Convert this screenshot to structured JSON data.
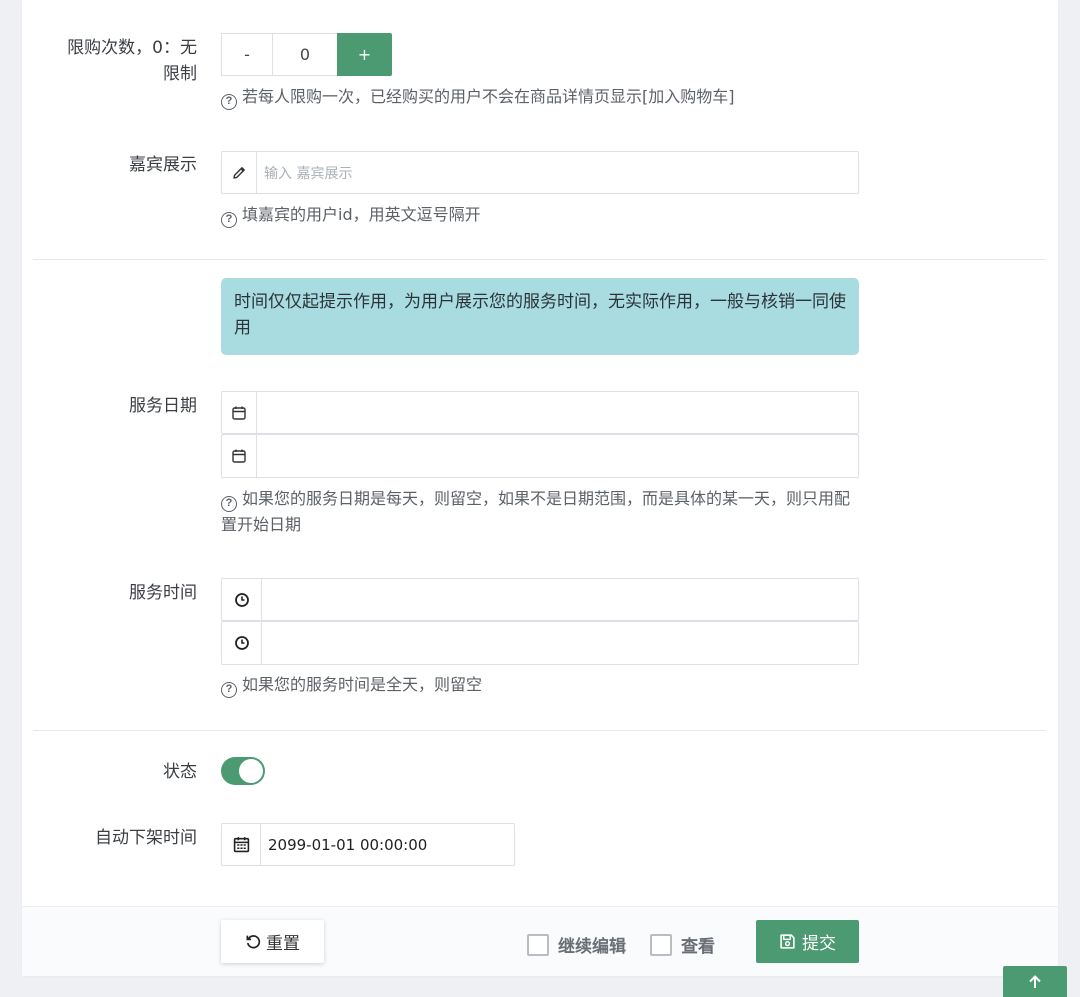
{
  "purchase_limit": {
    "label": "限购次数，0：无限制",
    "label_line1": "限购次数，0：无",
    "label_line2": "限制",
    "minus": "-",
    "value": "0",
    "plus": "+",
    "help": "若每人限购一次，已经购买的用户不会在商品详情页显示[加入购物车]"
  },
  "guests": {
    "label": "嘉宾展示",
    "placeholder": "输入 嘉宾展示",
    "help": "填嘉宾的用户id，用英文逗号隔开"
  },
  "notice": "时间仅仅起提示作用，为用户展示您的服务时间，无实际作用，一般与核销一同使用",
  "service_date": {
    "label": "服务日期",
    "start": "",
    "end": "",
    "help": "如果您的服务日期是每天，则留空，如果不是日期范围，而是具体的某一天，则只用配置开始日期"
  },
  "service_time": {
    "label": "服务时间",
    "start": "",
    "end": "",
    "help": "如果您的服务时间是全天，则留空"
  },
  "status": {
    "label": "状态",
    "on": true
  },
  "auto_off": {
    "label": "自动下架时间",
    "value": "2099-01-01 00:00:00"
  },
  "footer": {
    "reset": "重置",
    "continue_edit": "继续编辑",
    "view": "查看",
    "submit": "提交"
  },
  "colors": {
    "primary": "#4c9a72",
    "alert_bg": "#a8dce1"
  }
}
